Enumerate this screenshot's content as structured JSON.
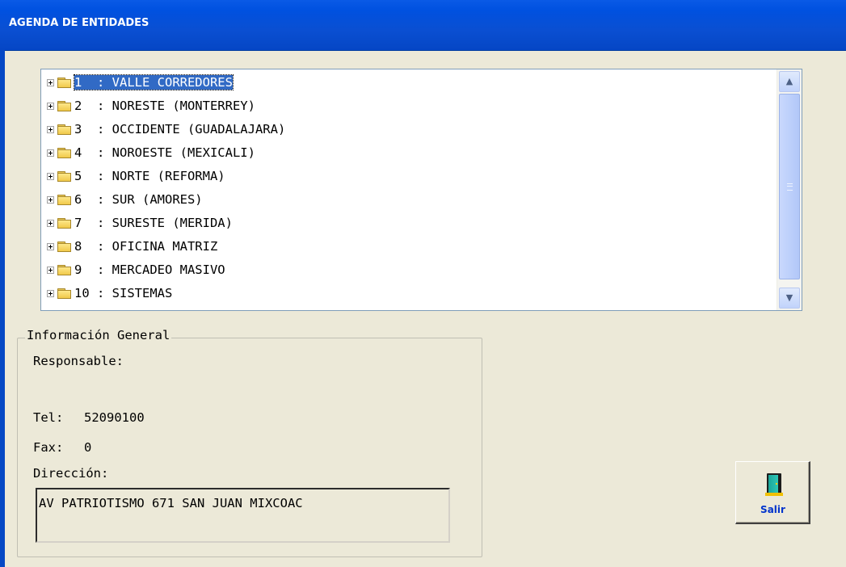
{
  "window": {
    "title": "AGENDA DE ENTIDADES"
  },
  "tree": {
    "items": [
      {
        "text": "1  : VALLE CORREDORES",
        "selected": true
      },
      {
        "text": "2  : NORESTE (MONTERREY)",
        "selected": false
      },
      {
        "text": "3  : OCCIDENTE (GUADALAJARA)",
        "selected": false
      },
      {
        "text": "4  : NOROESTE (MEXICALI)",
        "selected": false
      },
      {
        "text": "5  : NORTE (REFORMA)",
        "selected": false
      },
      {
        "text": "6  : SUR (AMORES)",
        "selected": false
      },
      {
        "text": "7  : SURESTE (MERIDA)",
        "selected": false
      },
      {
        "text": "8  : OFICINA MATRIZ",
        "selected": false
      },
      {
        "text": "9  : MERCADEO MASIVO",
        "selected": false
      },
      {
        "text": "10 : SISTEMAS",
        "selected": false
      }
    ],
    "scrollbar": {
      "up_icon": "▲",
      "down_icon": "▼"
    }
  },
  "info": {
    "legend": "Información General",
    "responsable_label": "Responsable:",
    "responsable_value": "",
    "tel_label": "Tel:",
    "tel_value": "52090100",
    "fax_label": "Fax:",
    "fax_value": "0",
    "direccion_label": "Dirección:",
    "direccion_value": "AV PATRIOTISMO 671 SAN JUAN MIXCOAC"
  },
  "buttons": {
    "exit_label": "Salir",
    "exit_icon": "door-exit-icon"
  },
  "colors": {
    "titlebar": "#0a4fd2",
    "selection": "#316ac5",
    "window_bg": "#ece9d8",
    "exit_text": "#0033cc"
  }
}
